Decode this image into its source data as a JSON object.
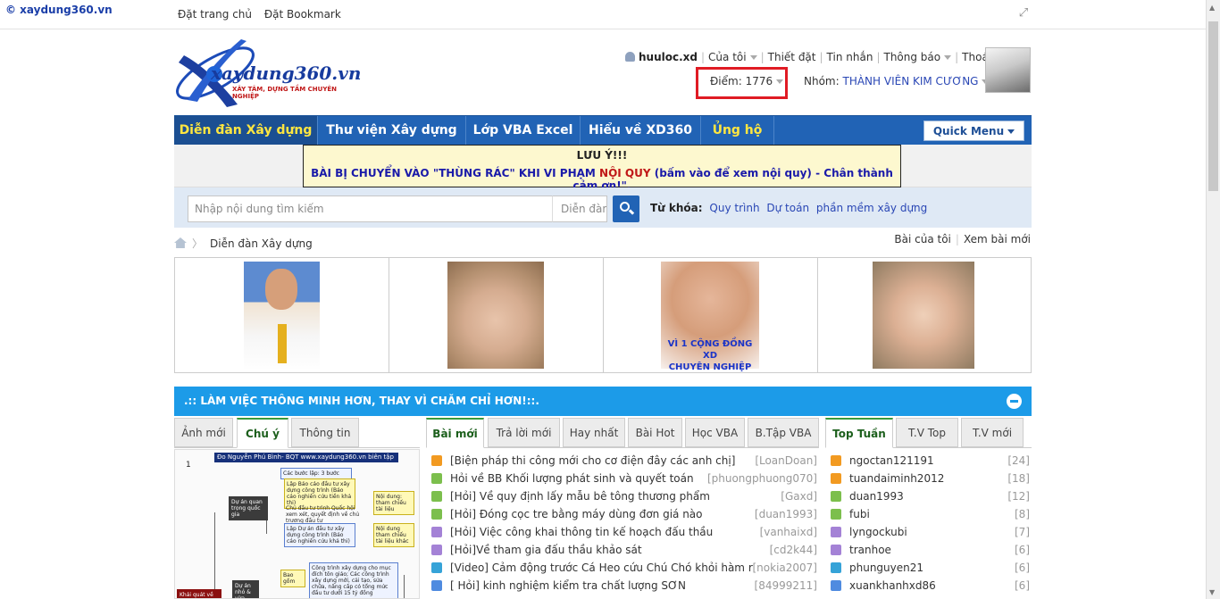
{
  "topbar": {
    "brand": "© xaydung360.vn",
    "links": [
      "Đặt trang chủ",
      "Đặt Bookmark"
    ]
  },
  "logo": {
    "name": "xaydung360.vn",
    "tagline": "XÂY TÂM, DỰNG TẦM CHUYÊN NGHIỆP"
  },
  "user": {
    "username": "huuloc.xd",
    "menu": [
      "Của tôi",
      "Thiết đặt",
      "Tin nhắn",
      "Thông báo",
      "Thoát"
    ],
    "points_label": "Điểm: 1776",
    "group_label": "Nhóm:",
    "group_value": "THÀNH VIÊN KIM CƯƠNG"
  },
  "nav": {
    "items": [
      "Diễn đàn Xây dựng",
      "Thư viện Xây dựng",
      "Lớp VBA Excel",
      "Hiểu về XD360",
      "Ủng hộ"
    ],
    "quick_menu": "Quick Menu"
  },
  "notice": {
    "title": "LƯU Ý!!!",
    "text_before": "BÀI BỊ CHUYỂN VÀO \"THÙNG RÁC\" KHI VI PHẠM ",
    "text_red": "NỘI QUY",
    "text_after": " (bấm vào để xem nội quy) - Chân thành cảm ơn!\"."
  },
  "search": {
    "placeholder": "Nhập nội dung tìm kiếm",
    "scope": "Diễn đàn",
    "keywords_label": "Từ khóa:",
    "keywords": [
      "Quy trình",
      "Dự toán",
      "phần mềm xây dựng"
    ]
  },
  "breadcrumb": {
    "current": "Diễn đàn Xây dựng",
    "right_links": [
      "Bài của tôi",
      "Xem bài mới"
    ]
  },
  "gallery": {
    "caption3": [
      "VÌ 1 CỘNG ĐỒNG XD",
      "CHUYÊN NGHIỆP"
    ]
  },
  "panel": {
    "title": ".:: LÀM VIỆC THÔNG MINH HƠN, THAY VÌ CHĂM CHỈ HƠN!::."
  },
  "col1": {
    "tabs": [
      "Ảnh mới",
      "Chú ý",
      "Thông tin"
    ],
    "active": 1,
    "diagram": {
      "header": "Đo Nguyễn Phú Bình- BQT www.xaydung360.vn biên tập",
      "num": "1",
      "n1": "Dự án quan trọng quốc gia",
      "n2": "Các bước lập: 3 bước",
      "n3": "Lập Báo cáo đầu tư xây dựng công trình (Báo cáo nghiên cứu tiền khả thi)",
      "n4": "Chủ đầu tư trình Quốc hội xem xét, quyết định về chủ trương đầu tư",
      "n5": "Lập Dự án đầu tư xây dựng công trình (Báo cáo nghiên cứu khả thi)",
      "n6": "Nội dung: tham chiếu tài liệu",
      "n7": "Nội dung tham chiếu tài liệu khác",
      "n8": "Dự án nhỏ & vừa",
      "n9": "Bao gồm",
      "n10": "Khái quát về",
      "n11": "Công trình xây dựng cho mục đích tôn giáo; Các công trình xây dựng mới, cải tạo, sửa chữa, nâng cấp có tổng mức đầu tư dưới 15 tỷ đồng"
    }
  },
  "col2": {
    "tabs": [
      "Bài mới",
      "Trả lời mới",
      "Hay nhất",
      "Bài Hot",
      "Học VBA",
      "B.Tập VBA"
    ],
    "active": 0,
    "rows": [
      {
        "text": "[Biện pháp thi công mới cho cơ điện đây các anh chị]",
        "meta": "[LoanDoan]",
        "icon": "orange"
      },
      {
        "text": "Hỏi về BB Khối lượng phát sinh và quyết toán",
        "meta": "[phuongphuong070]",
        "icon": "green"
      },
      {
        "text": "[Hỏi] Về quy định lấy mẫu bê tông thương phẩm",
        "meta": "[Gaxd]",
        "icon": "green"
      },
      {
        "text": "[Hỏi] Đóng cọc tre bằng máy dùng đơn giá nào",
        "meta": "[duan1993]",
        "icon": "green"
      },
      {
        "text": "[Hỏi] Việc công khai thông tin kế hoạch đấu thầu",
        "meta": "[vanhaixd]",
        "icon": "purple"
      },
      {
        "text": "[Hỏi]Về tham gia đấu thầu khảo sát",
        "meta": "[cd2k44]",
        "icon": "purple"
      },
      {
        "text": "[Video] Cảm động trước Cá Heo cứu Chú Chó khỏi hàm răng Cá",
        "meta": "[nokia2007]",
        "icon": "teal"
      },
      {
        "text": "[ Hỏi] kinh nghiệm kiểm tra chất lượng SƠN",
        "meta": "[84999211]",
        "icon": "blue"
      }
    ]
  },
  "col3": {
    "tabs": [
      "Top Tuần",
      "T.V Top",
      "T.V mới"
    ],
    "active": 0,
    "rows": [
      {
        "text": "ngoctan121191",
        "meta": "[24]",
        "icon": "orange"
      },
      {
        "text": "tuandaiminh2012",
        "meta": "[18]",
        "icon": "orange"
      },
      {
        "text": "duan1993",
        "meta": "[12]",
        "icon": "green"
      },
      {
        "text": "fubi",
        "meta": "[8]",
        "icon": "green"
      },
      {
        "text": "lyngockubi",
        "meta": "[7]",
        "icon": "purple"
      },
      {
        "text": "tranhoe",
        "meta": "[6]",
        "icon": "purple"
      },
      {
        "text": "phunguyen21",
        "meta": "[6]",
        "icon": "teal"
      },
      {
        "text": "xuankhanhxd86",
        "meta": "[6]",
        "icon": "blue"
      }
    ]
  }
}
